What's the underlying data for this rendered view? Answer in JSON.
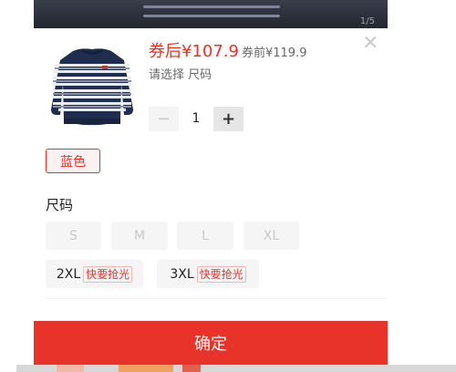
{
  "product": {
    "price_label": "券后¥107.9",
    "original_price_label": "券前¥119.9",
    "select_hint": "请选择 尺码"
  },
  "quantity": {
    "value": "1",
    "minus_symbol": "−",
    "plus_symbol": "+"
  },
  "colors": {
    "selected": "蓝色"
  },
  "size": {
    "title": "尺码",
    "options": [
      {
        "label": "S",
        "available": false
      },
      {
        "label": "M",
        "available": false
      },
      {
        "label": "L",
        "available": false
      },
      {
        "label": "XL",
        "available": false
      },
      {
        "label": "2XL",
        "available": true,
        "tag": "快要抢光"
      },
      {
        "label": "3XL",
        "available": true,
        "tag": "快要抢光"
      }
    ]
  },
  "confirm_label": "确定",
  "close_symbol": "×",
  "image_indicator": "1/5",
  "theme": {
    "accent": "#e8332a",
    "sweater_navy": "#1f2d4f",
    "sweater_stripe": "#e9ebf0"
  }
}
